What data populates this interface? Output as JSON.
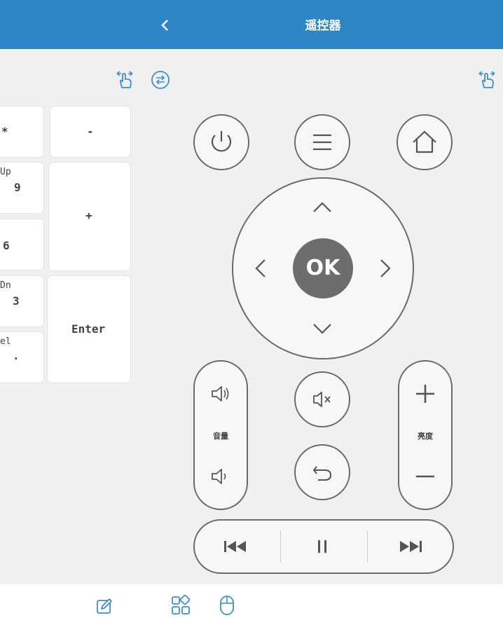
{
  "header": {
    "title": "遥控器",
    "back_icon": "chevron-left-icon"
  },
  "toolbar": {
    "left_icons": [
      "hand-gesture-icon",
      "switch-icon"
    ],
    "right_icon": "hand-gesture-icon"
  },
  "keypad": {
    "keys": [
      {
        "main": "*",
        "sub": ""
      },
      {
        "main": "-",
        "sub": ""
      },
      {
        "main": "9",
        "sub": "Up"
      },
      {
        "main": "+",
        "sub": ""
      },
      {
        "main": "6",
        "sub": ""
      },
      {
        "main": "3",
        "sub": "Dn"
      },
      {
        "main": "Enter",
        "sub": ""
      },
      {
        "main": ".",
        "sub": "el"
      }
    ]
  },
  "remote": {
    "power_icon": "power-icon",
    "menu_icon": "menu-icon",
    "home_icon": "home-icon",
    "ok_label": "OK",
    "volume_label": "音量",
    "brightness_label": "亮度",
    "mute_icon": "mute-icon",
    "return_icon": "return-icon",
    "media": [
      "previous-icon",
      "pause-icon",
      "next-icon"
    ]
  },
  "bottom_bar": {
    "icons": [
      "edit-icon",
      "apps-icon",
      "mouse-icon"
    ]
  },
  "colors": {
    "header": "#2f86c7",
    "accent_icon": "#3a8fd0",
    "ok_button": "#6d6d6d"
  }
}
